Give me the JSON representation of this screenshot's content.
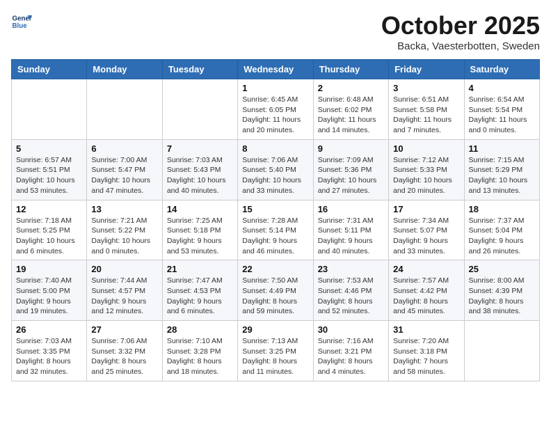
{
  "header": {
    "logo_line1": "General",
    "logo_line2": "Blue",
    "month_title": "October 2025",
    "location": "Backa, Vaesterbotten, Sweden"
  },
  "weekdays": [
    "Sunday",
    "Monday",
    "Tuesday",
    "Wednesday",
    "Thursday",
    "Friday",
    "Saturday"
  ],
  "weeks": [
    [
      {
        "day": "",
        "info": ""
      },
      {
        "day": "",
        "info": ""
      },
      {
        "day": "",
        "info": ""
      },
      {
        "day": "1",
        "info": "Sunrise: 6:45 AM\nSunset: 6:05 PM\nDaylight: 11 hours\nand 20 minutes."
      },
      {
        "day": "2",
        "info": "Sunrise: 6:48 AM\nSunset: 6:02 PM\nDaylight: 11 hours\nand 14 minutes."
      },
      {
        "day": "3",
        "info": "Sunrise: 6:51 AM\nSunset: 5:58 PM\nDaylight: 11 hours\nand 7 minutes."
      },
      {
        "day": "4",
        "info": "Sunrise: 6:54 AM\nSunset: 5:54 PM\nDaylight: 11 hours\nand 0 minutes."
      }
    ],
    [
      {
        "day": "5",
        "info": "Sunrise: 6:57 AM\nSunset: 5:51 PM\nDaylight: 10 hours\nand 53 minutes."
      },
      {
        "day": "6",
        "info": "Sunrise: 7:00 AM\nSunset: 5:47 PM\nDaylight: 10 hours\nand 47 minutes."
      },
      {
        "day": "7",
        "info": "Sunrise: 7:03 AM\nSunset: 5:43 PM\nDaylight: 10 hours\nand 40 minutes."
      },
      {
        "day": "8",
        "info": "Sunrise: 7:06 AM\nSunset: 5:40 PM\nDaylight: 10 hours\nand 33 minutes."
      },
      {
        "day": "9",
        "info": "Sunrise: 7:09 AM\nSunset: 5:36 PM\nDaylight: 10 hours\nand 27 minutes."
      },
      {
        "day": "10",
        "info": "Sunrise: 7:12 AM\nSunset: 5:33 PM\nDaylight: 10 hours\nand 20 minutes."
      },
      {
        "day": "11",
        "info": "Sunrise: 7:15 AM\nSunset: 5:29 PM\nDaylight: 10 hours\nand 13 minutes."
      }
    ],
    [
      {
        "day": "12",
        "info": "Sunrise: 7:18 AM\nSunset: 5:25 PM\nDaylight: 10 hours\nand 6 minutes."
      },
      {
        "day": "13",
        "info": "Sunrise: 7:21 AM\nSunset: 5:22 PM\nDaylight: 10 hours\nand 0 minutes."
      },
      {
        "day": "14",
        "info": "Sunrise: 7:25 AM\nSunset: 5:18 PM\nDaylight: 9 hours\nand 53 minutes."
      },
      {
        "day": "15",
        "info": "Sunrise: 7:28 AM\nSunset: 5:14 PM\nDaylight: 9 hours\nand 46 minutes."
      },
      {
        "day": "16",
        "info": "Sunrise: 7:31 AM\nSunset: 5:11 PM\nDaylight: 9 hours\nand 40 minutes."
      },
      {
        "day": "17",
        "info": "Sunrise: 7:34 AM\nSunset: 5:07 PM\nDaylight: 9 hours\nand 33 minutes."
      },
      {
        "day": "18",
        "info": "Sunrise: 7:37 AM\nSunset: 5:04 PM\nDaylight: 9 hours\nand 26 minutes."
      }
    ],
    [
      {
        "day": "19",
        "info": "Sunrise: 7:40 AM\nSunset: 5:00 PM\nDaylight: 9 hours\nand 19 minutes."
      },
      {
        "day": "20",
        "info": "Sunrise: 7:44 AM\nSunset: 4:57 PM\nDaylight: 9 hours\nand 12 minutes."
      },
      {
        "day": "21",
        "info": "Sunrise: 7:47 AM\nSunset: 4:53 PM\nDaylight: 9 hours\nand 6 minutes."
      },
      {
        "day": "22",
        "info": "Sunrise: 7:50 AM\nSunset: 4:49 PM\nDaylight: 8 hours\nand 59 minutes."
      },
      {
        "day": "23",
        "info": "Sunrise: 7:53 AM\nSunset: 4:46 PM\nDaylight: 8 hours\nand 52 minutes."
      },
      {
        "day": "24",
        "info": "Sunrise: 7:57 AM\nSunset: 4:42 PM\nDaylight: 8 hours\nand 45 minutes."
      },
      {
        "day": "25",
        "info": "Sunrise: 8:00 AM\nSunset: 4:39 PM\nDaylight: 8 hours\nand 38 minutes."
      }
    ],
    [
      {
        "day": "26",
        "info": "Sunrise: 7:03 AM\nSunset: 3:35 PM\nDaylight: 8 hours\nand 32 minutes."
      },
      {
        "day": "27",
        "info": "Sunrise: 7:06 AM\nSunset: 3:32 PM\nDaylight: 8 hours\nand 25 minutes."
      },
      {
        "day": "28",
        "info": "Sunrise: 7:10 AM\nSunset: 3:28 PM\nDaylight: 8 hours\nand 18 minutes."
      },
      {
        "day": "29",
        "info": "Sunrise: 7:13 AM\nSunset: 3:25 PM\nDaylight: 8 hours\nand 11 minutes."
      },
      {
        "day": "30",
        "info": "Sunrise: 7:16 AM\nSunset: 3:21 PM\nDaylight: 8 hours\nand 4 minutes."
      },
      {
        "day": "31",
        "info": "Sunrise: 7:20 AM\nSunset: 3:18 PM\nDaylight: 7 hours\nand 58 minutes."
      },
      {
        "day": "",
        "info": ""
      }
    ]
  ]
}
